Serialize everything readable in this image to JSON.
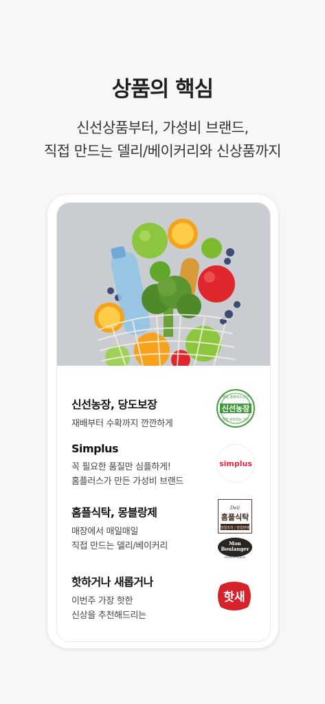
{
  "headline": "상품의 핵심",
  "subline": [
    "신선상품부터, 가성비 브랜드,",
    "직접 만드는 델리/베이커리와 신상품까지"
  ],
  "items": [
    {
      "title": "신선농장, 당도보장",
      "desc": [
        "재배부터 수확까지 깐깐하게"
      ],
      "logo": {
        "main": "신선농장",
        "top": "매일 홈플러스신선",
        "bottom": "직접 관리하는 신선",
        "color": "#3f9a3c"
      }
    },
    {
      "title": "Simplus",
      "desc": [
        "꼭 필요한 품질만 심플하게!",
        "홈플러스가 만든 가성비 브랜드"
      ],
      "logo": {
        "main": "simplus",
        "color": "#e8273a"
      }
    },
    {
      "title": "홈플식탁, 몽블랑제",
      "desc": [
        "매장에서 매일매일",
        "직접 만드는 델리/베이커리"
      ],
      "logo": {
        "deli": "Deli",
        "main": "홈플식탁",
        "tag": "당일조리 / 당일판매",
        "bakery_line1": "Mon",
        "bakery_line2": "Boulanger",
        "bakery_tag": "PREMIUM BAKERY"
      }
    },
    {
      "title": "핫하거나 새롭거나",
      "desc": [
        "이번주 가장 핫한",
        "신상을 추천해드리는"
      ],
      "logo": {
        "main": "핫새",
        "color": "#d8222b"
      }
    }
  ]
}
